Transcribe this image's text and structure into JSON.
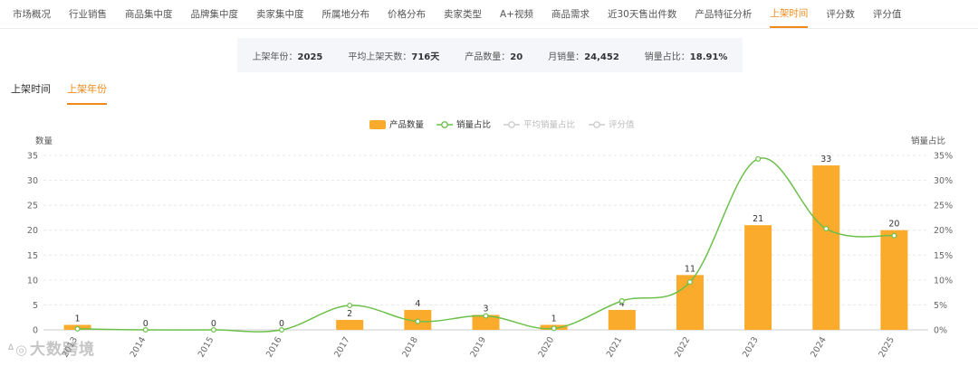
{
  "nav": {
    "items": [
      "市场概况",
      "行业销售",
      "商品集中度",
      "品牌集中度",
      "卖家集中度",
      "所属地分布",
      "价格分布",
      "卖家类型",
      "A+视频",
      "商品需求",
      "近30天售出件数",
      "产品特征分析",
      "上架时间",
      "评分数",
      "评分值"
    ],
    "active_index": 12
  },
  "summary": {
    "year_label": "上架年份：",
    "year_value": "2025",
    "avgdays_label": "平均上架天数：",
    "avgdays_value": "716天",
    "count_label": "产品数量：",
    "count_value": "20",
    "sales_label": "月销量：",
    "sales_value": "24,452",
    "share_label": "销量占比：",
    "share_value": "18.91%"
  },
  "subtabs": {
    "time": "上架时间",
    "year": "上架年份",
    "active": "year"
  },
  "colors": {
    "accent": "#f08a1a",
    "bar": "#fbab2b",
    "line": "#6cc04a",
    "disabled": "#cccccc"
  },
  "watermark": "大数跨境",
  "chart_data": {
    "type": "bar",
    "categories": [
      "2013",
      "2014",
      "2015",
      "2016",
      "2017",
      "2018",
      "2019",
      "2020",
      "2021",
      "2022",
      "2023",
      "2024",
      "2025"
    ],
    "series": [
      {
        "name": "产品数量",
        "type": "bar",
        "axis": "left",
        "values": [
          1,
          0,
          0,
          0,
          2,
          4,
          3,
          1,
          4,
          11,
          21,
          33,
          20
        ],
        "visible": true
      },
      {
        "name": "销量占比",
        "type": "line",
        "axis": "right",
        "values": [
          0.2,
          0,
          0,
          0,
          4.9,
          1.7,
          2.8,
          0.3,
          5.8,
          9.6,
          34.3,
          20.3,
          18.9
        ],
        "visible": true
      },
      {
        "name": "平均销量占比",
        "type": "line",
        "visible": false
      },
      {
        "name": "评分值",
        "type": "line",
        "visible": false
      }
    ],
    "ylabel_left": "数量",
    "ylabel_right": "销量占比",
    "ylim_left": [
      0,
      35
    ],
    "yticks_left": [
      "0",
      "5",
      "10",
      "15",
      "20",
      "25",
      "30",
      "35"
    ],
    "ylim_right": [
      0,
      35
    ],
    "yticks_right": [
      "0%",
      "5%",
      "10%",
      "15%",
      "20%",
      "25%",
      "30%",
      "35%"
    ],
    "data_labels": [
      "1",
      "0",
      "0",
      "0",
      "2",
      "4",
      "3",
      "1",
      "4",
      "11",
      "21",
      "33",
      "20"
    ],
    "legend": "top-center",
    "grid": true
  }
}
